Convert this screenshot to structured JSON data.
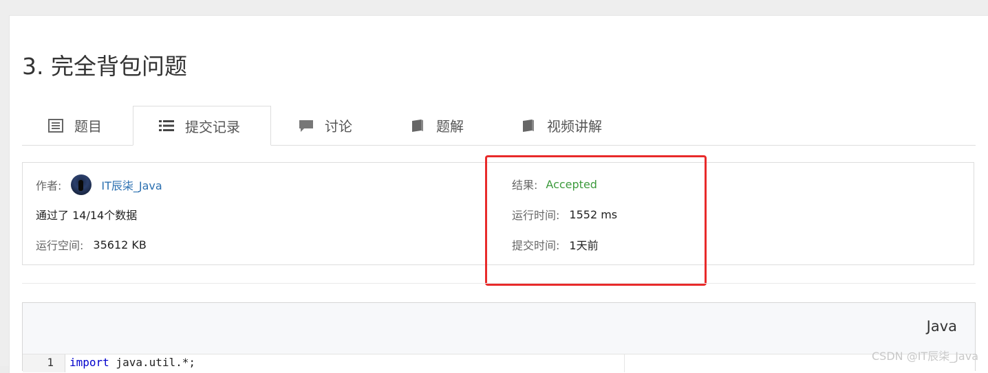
{
  "problem": {
    "title": "3. 完全背包问题"
  },
  "tabs": [
    {
      "label": "题目",
      "icon": "list-icon"
    },
    {
      "label": "提交记录",
      "icon": "list-bullets-icon"
    },
    {
      "label": "讨论",
      "icon": "comment-icon"
    },
    {
      "label": "题解",
      "icon": "book-icon"
    },
    {
      "label": "视频讲解",
      "icon": "book-icon"
    }
  ],
  "submission": {
    "author_label": "作者:",
    "author_name": "IT辰柒_Java",
    "passed_text": "通过了 14/14个数据",
    "memory_label": "运行空间:",
    "memory_value": "35612 KB",
    "result_label": "结果:",
    "result_value": "Accepted",
    "runtime_label": "运行时间:",
    "runtime_value": "1552 ms",
    "submit_time_label": "提交时间:",
    "submit_time_value": "1天前"
  },
  "code": {
    "language": "Java",
    "line_number": "1",
    "keyword": "import",
    "rest": " java.util.*;"
  },
  "watermark": "CSDN @IT辰柒_Java",
  "colors": {
    "accepted": "#3c9a3c",
    "link": "#2a6fb0",
    "highlight": "#e82a2a"
  }
}
